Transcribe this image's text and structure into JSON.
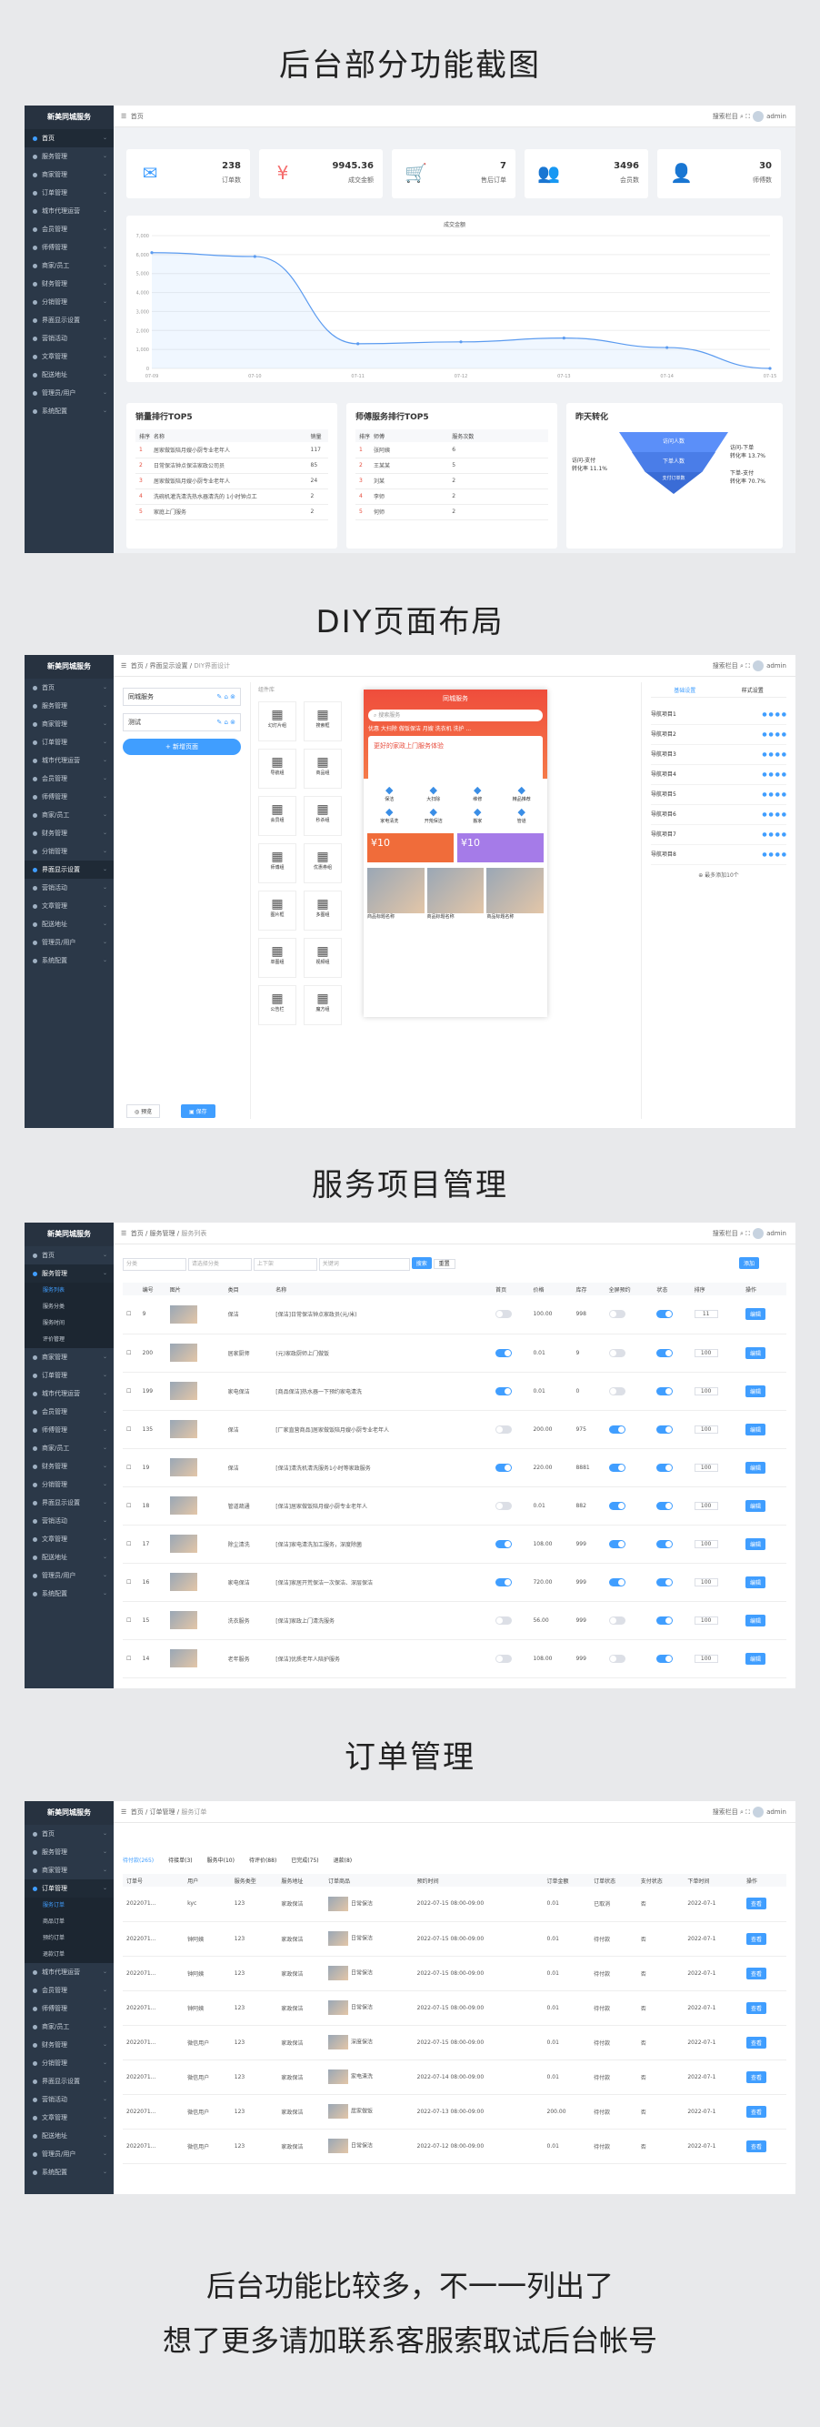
{
  "section_titles": [
    "后台部分功能截图",
    "DIY页面布局",
    "服务项目管理",
    "订单管理"
  ],
  "footer_lines": [
    "后台功能比较多，不一一列出了",
    "想了更多请加联系客服索取试后台帐号"
  ],
  "app_name": "新美同城服务",
  "sidebar": [
    "首页",
    "服务管理",
    "商家管理",
    "订单管理",
    "城市代理运营",
    "会员管理",
    "师傅管理",
    "商家/员工",
    "财务管理",
    "分销管理",
    "界面显示设置",
    "营销活动",
    "文章管理",
    "配送地址",
    "管理员/用户",
    "系统配置"
  ],
  "topbar": {
    "home": "首页",
    "search_label": "搜索栏目",
    "user": "admin"
  },
  "dashboard": {
    "stats": [
      {
        "value": "238",
        "label": "订单数",
        "icon": "chat-icon",
        "color": "#409eff"
      },
      {
        "value": "9945.36",
        "label": "成交金额",
        "icon": "yen-icon",
        "color": "#f56c6c"
      },
      {
        "value": "7",
        "label": "售后订单",
        "icon": "cart-icon",
        "color": "#67c23a"
      },
      {
        "value": "3496",
        "label": "会员数",
        "icon": "users-icon",
        "color": "#36b3a8"
      },
      {
        "value": "30",
        "label": "师傅数",
        "icon": "worker-icon",
        "color": "#36b3a8"
      }
    ],
    "chart_legend": "成交金额",
    "top_sales_title": "销量排行TOP5",
    "top_service_title": "师傅服务排行TOP5",
    "conversion_title": "昨天转化",
    "sales_headers": [
      "排序",
      "名称",
      "销量"
    ],
    "sales_rows": [
      [
        "1",
        "居家做饭陪月嫂小厨专业老年人",
        "117"
      ],
      [
        "2",
        "日常保洁钟点保洁家政公司员",
        "85"
      ],
      [
        "3",
        "居家做饭陪月嫂小厨专业老年人",
        "24"
      ],
      [
        "4",
        "洗碗机灌洗清洗热水器清洗的 1小时钟点工",
        "2"
      ],
      [
        "5",
        "家庭上门服务",
        "2"
      ]
    ],
    "service_headers": [
      "排序",
      "师傅",
      "服务次数"
    ],
    "service_rows": [
      [
        "1",
        "张阿姨",
        "6"
      ],
      [
        "2",
        "王某某",
        "5"
      ],
      [
        "3",
        "刘某",
        "2"
      ],
      [
        "4",
        "李师",
        "2"
      ],
      [
        "5",
        "何师",
        "2"
      ]
    ],
    "funnel_labels": [
      "访问人数",
      "下单人数",
      "支付订单数"
    ],
    "funnel_left": "访问-支付\n转化率 11.1%",
    "funnel_right_top": "访问-下单\n转化率 13.7%",
    "funnel_right_bottom": "下单-支付\n转化率 70.7%"
  },
  "chart_data": {
    "type": "line",
    "x": [
      "07-09",
      "07-10",
      "07-11",
      "07-12",
      "07-13",
      "07-14",
      "07-15"
    ],
    "series": [
      {
        "name": "成交金额",
        "values": [
          6100,
          5900,
          1300,
          1400,
          1600,
          1100,
          0
        ]
      }
    ],
    "ylim": [
      0,
      7000
    ],
    "yticks": [
      "0",
      "1,000",
      "2,000",
      "3,000",
      "4,000",
      "5,000",
      "6,000",
      "7,000"
    ],
    "title": "",
    "xlabel": "",
    "ylabel": ""
  },
  "diy": {
    "crumb": [
      "首页",
      "界面显示设置",
      "DIY界面设计"
    ],
    "pages": [
      "同城服务",
      "测试"
    ],
    "add_page": "新增页面",
    "preview": "预览",
    "save": "保存",
    "widget_header": "组件库",
    "widgets": [
      "幻灯片组",
      "搜索框",
      "导航组",
      "商品组",
      "会员组",
      "秒杀组",
      "师傅组",
      "优惠券组",
      "图片框",
      "多图组",
      "单图组",
      "视频组",
      "公告栏",
      "魔方组"
    ],
    "phone_title": "同城服务",
    "phone_search": "搜索服务",
    "phone_tags": "优惠 大扫除 做饭保洁 月嫂 洗衣机 洗护 ...",
    "phone_banner": "更好的家政上门服务体验",
    "phone_icons": [
      "保洁",
      "大扫除",
      "维修",
      "精品推荐",
      "家电清洗",
      "开荒保洁",
      "搬家",
      "管道"
    ],
    "phone_coupon": "¥10",
    "phone_goods": "商品标题名称",
    "tabs": [
      "基础设置",
      "样式设置"
    ],
    "nav_rows": [
      "导航项目1",
      "导航项目2",
      "导航项目3",
      "导航项目4",
      "导航项目5",
      "导航项目6",
      "导航项目7",
      "导航项目8"
    ],
    "add_nav": "最多添加10个"
  },
  "service": {
    "crumb": [
      "首页",
      "服务管理",
      "服务列表"
    ],
    "submenu": [
      "服务列表",
      "服务分类",
      "服务时间",
      "评价管理"
    ],
    "filters": [
      "分类",
      "请选择分类",
      "上下架",
      "关键词"
    ],
    "search_btn": "搜索",
    "reset_btn": "重置",
    "add_btn": "添加",
    "headers": [
      "",
      "编号",
      "图片",
      "类目",
      "名称",
      "首页",
      "价格",
      "库存",
      "全屏预约",
      "状态",
      "排序",
      "操作"
    ],
    "rows": [
      [
        "9",
        "保洁",
        "[保洁]日常保洁钟点家政员(元/米)",
        "0",
        "100.00",
        "998",
        "0",
        "1",
        "11"
      ],
      [
        "200",
        "居家厨师",
        "(元)家政厨师上门做饭",
        "1",
        "0.01",
        "9",
        "0",
        "1",
        "100"
      ],
      [
        "199",
        "家电保洁",
        "[商品保洁]热水器一下预约家电清洗",
        "1",
        "0.01",
        "0",
        "0",
        "1",
        "100"
      ],
      [
        "135",
        "保洁",
        "[厂家直营商品]居家做饭陪月嫂小厨专业老年人",
        "0",
        "200.00",
        "975",
        "1",
        "1",
        "100"
      ],
      [
        "19",
        "保洁",
        "[保洁]清洗机清洗服务1小时等家政服务",
        "1",
        "220.00",
        "8881",
        "1",
        "1",
        "100"
      ],
      [
        "18",
        "管道疏通",
        "[保洁]居家做饭陪月嫂小厨专业老年人",
        "0",
        "0.01",
        "882",
        "1",
        "1",
        "100"
      ],
      [
        "17",
        "除尘清洗",
        "[保洁]家电清洗加工服务，深度除菌",
        "1",
        "108.00",
        "999",
        "1",
        "1",
        "100"
      ],
      [
        "16",
        "家电保洁",
        "[保洁]家居开荒保洁一次保洁、深层保洁",
        "1",
        "720.00",
        "999",
        "1",
        "1",
        "100"
      ],
      [
        "15",
        "洗衣服务",
        "[保洁]家政上门清洗服务",
        "0",
        "56.00",
        "999",
        "0",
        "1",
        "100"
      ],
      [
        "14",
        "老年服务",
        "[保洁]优质老年人陪护服务",
        "0",
        "108.00",
        "999",
        "0",
        "1",
        "100"
      ]
    ],
    "edit": "编辑"
  },
  "orders": {
    "crumb": [
      "首页",
      "订单管理",
      "服务订单"
    ],
    "submenu": [
      "服务订单",
      "商品订单",
      "预约订单",
      "退款订单"
    ],
    "status_tabs": [
      "待付款(265)",
      "待接单(3)",
      "服务中(10)",
      "待评价(88)",
      "已完成(75)",
      "退款(8)"
    ],
    "headers": [
      "订单号",
      "用户",
      "服务类型",
      "服务地址",
      "订单商品",
      "预约时间",
      "订单金额",
      "订单状态",
      "支付状态",
      "下单时间",
      "操作"
    ],
    "rows": [
      [
        "2022071...",
        "kyc",
        "123",
        "家政保洁",
        "日常保洁",
        "2022-07-15 08:00-09:00",
        "0.01",
        "已取消",
        "否",
        "2022-07-1"
      ],
      [
        "2022071...",
        "钟阿姨",
        "123",
        "家政保洁",
        "日常保洁",
        "2022-07-15 08:00-09:00",
        "0.01",
        "待付款",
        "否",
        "2022-07-1"
      ],
      [
        "2022071...",
        "钟阿姨",
        "123",
        "家政保洁",
        "日常保洁",
        "2022-07-15 08:00-09:00",
        "0.01",
        "待付款",
        "否",
        "2022-07-1"
      ],
      [
        "2022071...",
        "钟阿姨",
        "123",
        "家政保洁",
        "日常保洁",
        "2022-07-15 08:00-09:00",
        "0.01",
        "待付款",
        "否",
        "2022-07-1"
      ],
      [
        "2022071...",
        "微信用户",
        "123",
        "家政保洁",
        "深度保洁",
        "2022-07-15 08:00-09:00",
        "0.01",
        "待付款",
        "否",
        "2022-07-1"
      ],
      [
        "2022071...",
        "微信用户",
        "123",
        "家政保洁",
        "家电清洗",
        "2022-07-14 08:00-09:00",
        "0.01",
        "待付款",
        "否",
        "2022-07-1"
      ],
      [
        "2022071...",
        "微信用户",
        "123",
        "家政保洁",
        "居家做饭",
        "2022-07-13 08:00-09:00",
        "200.00",
        "待付款",
        "否",
        "2022-07-1"
      ],
      [
        "2022071...",
        "微信用户",
        "123",
        "家政保洁",
        "日常保洁",
        "2022-07-12 08:00-09:00",
        "0.01",
        "待付款",
        "否",
        "2022-07-1"
      ]
    ],
    "view": "查看"
  }
}
